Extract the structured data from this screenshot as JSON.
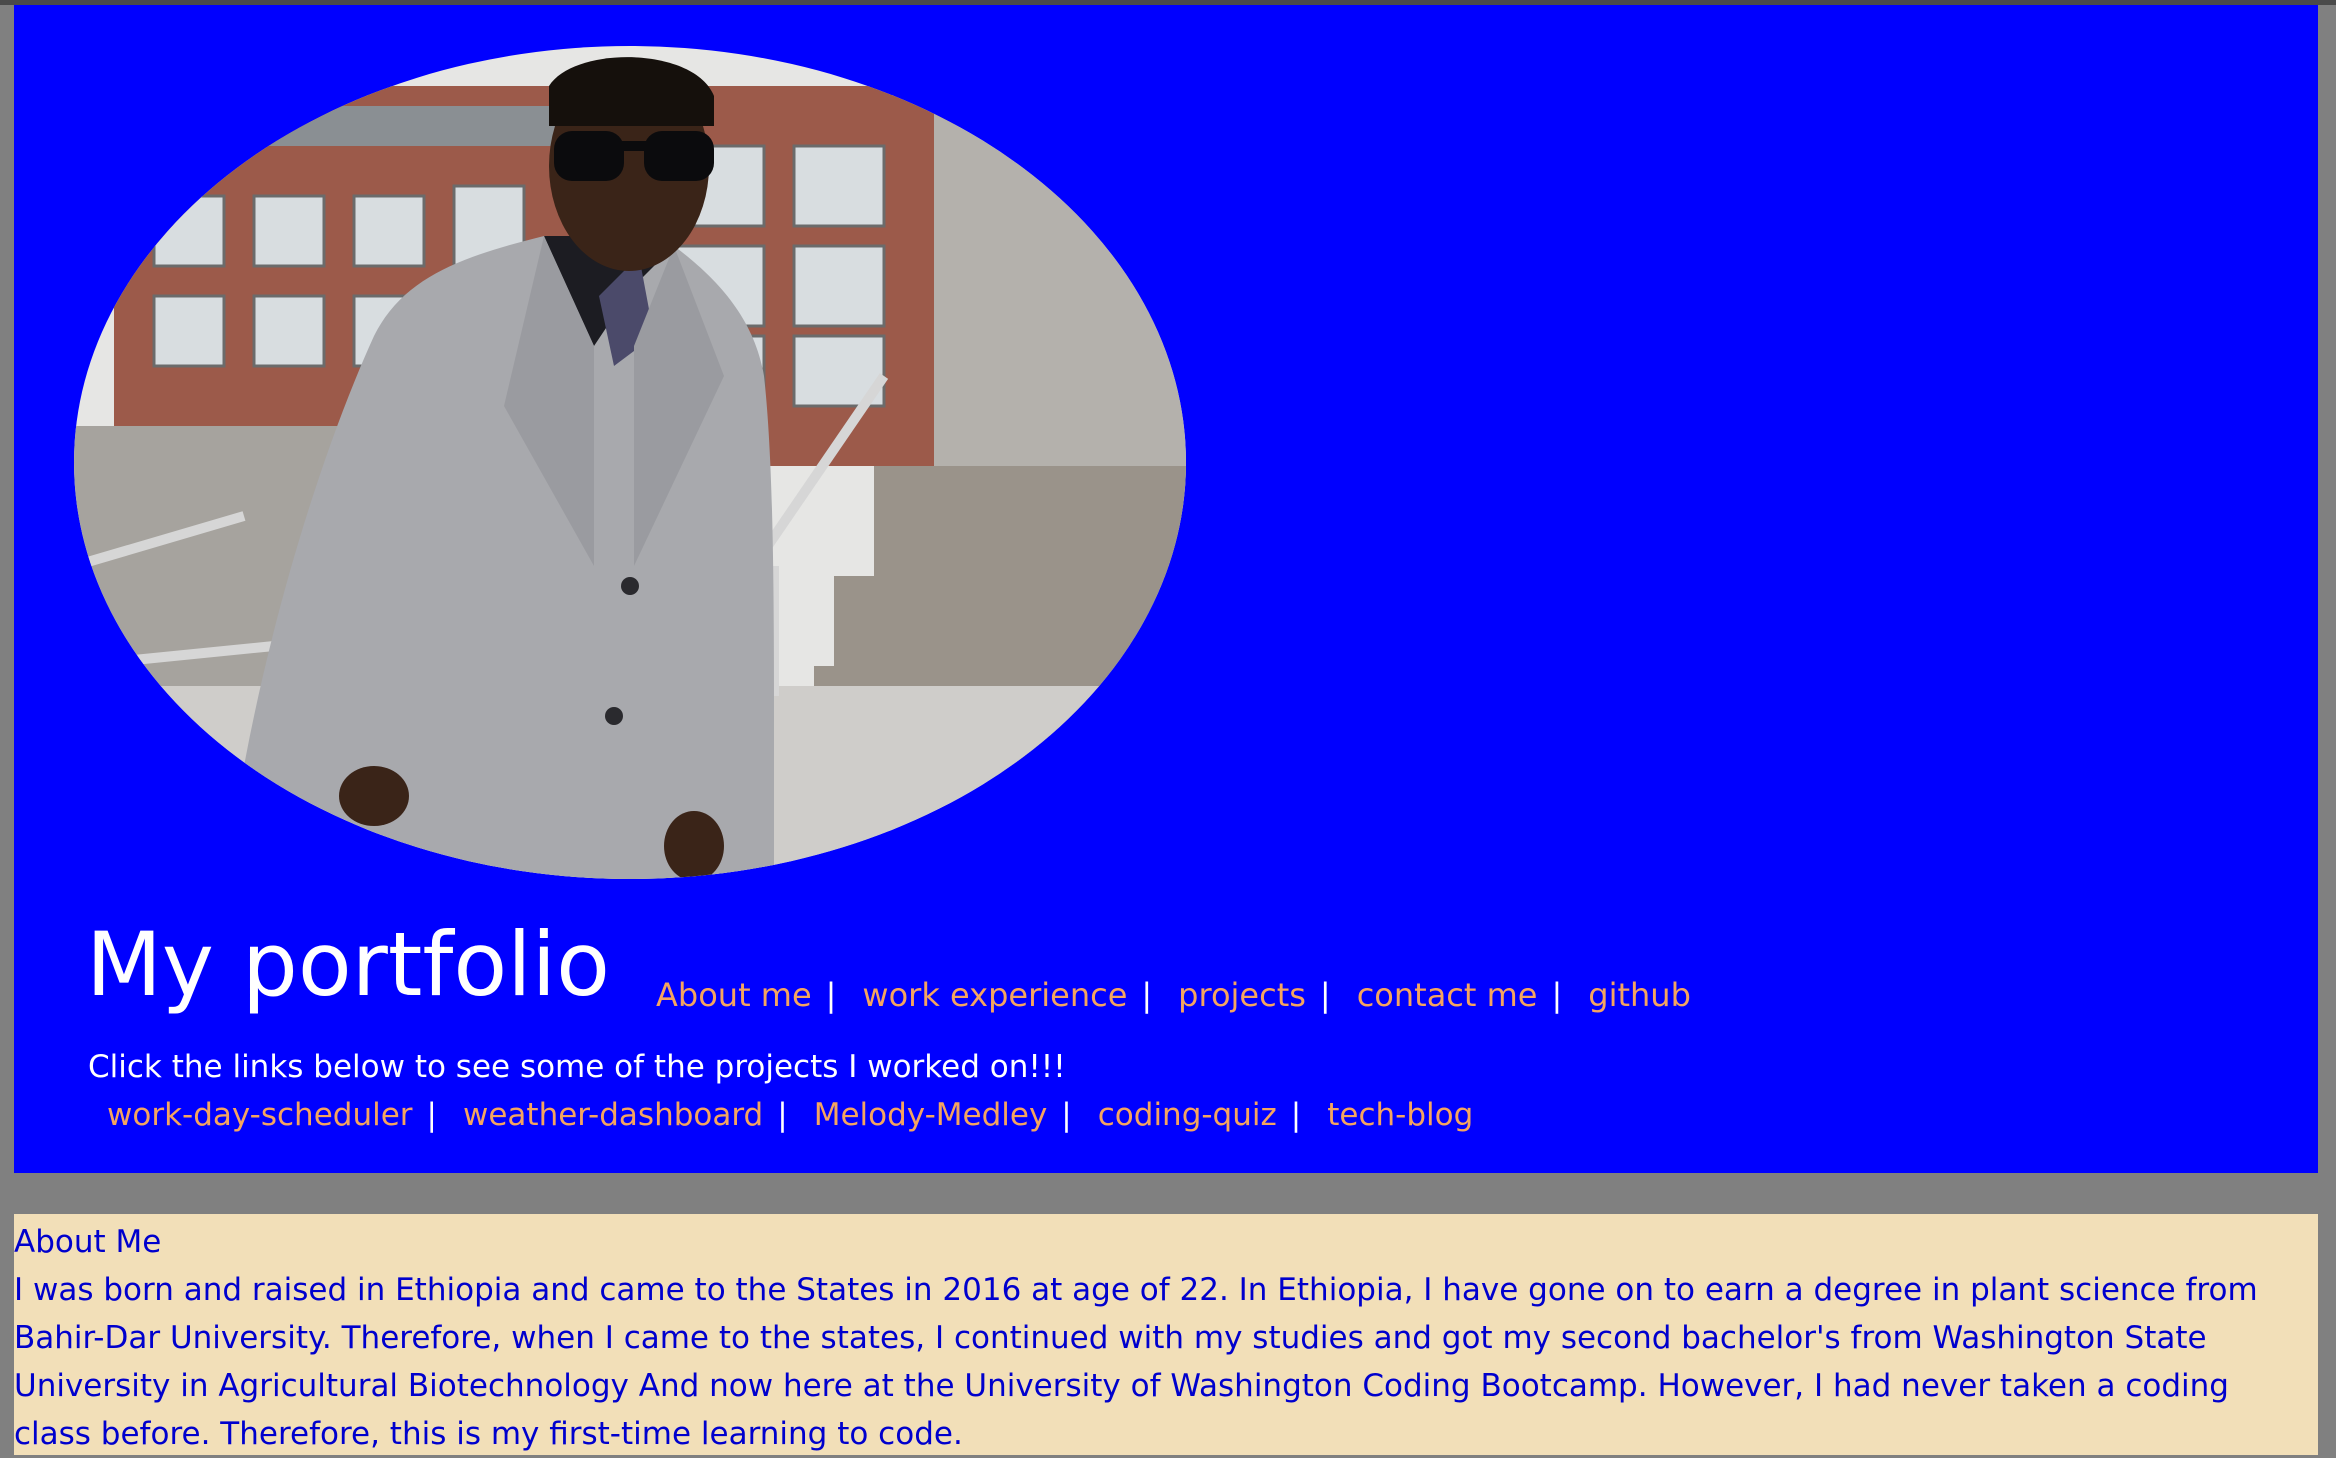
{
  "header": {
    "title": "My portfolio",
    "photo_alt": "portrait photo in grey suit in front of a building",
    "nav": [
      {
        "label": "About me"
      },
      {
        "label": "work experience"
      },
      {
        "label": "projects"
      },
      {
        "label": "contact me"
      },
      {
        "label": "github"
      }
    ],
    "separator": "|",
    "tagline": "Click the links below to see some of the projects I worked on!!!",
    "projects": [
      {
        "label": "work-day-scheduler"
      },
      {
        "label": "weather-dashboard"
      },
      {
        "label": "Melody-Medley"
      },
      {
        "label": "coding-quiz"
      },
      {
        "label": "tech-blog"
      }
    ]
  },
  "about": {
    "heading": "About Me",
    "text": "I was born and raised in Ethiopia and came to the States in 2016 at age of 22. In Ethiopia, I have gone on to earn a degree in plant science from Bahir-Dar University. Therefore, when I came to the states, I continued with my studies and got my second bachelor's from Washington State University in Agricultural Biotechnology And now here at the University of Washington Coding Bootcamp. However, I had never taken a coding class before. Therefore, this is my first-time learning to code."
  },
  "colors": {
    "page_background": "#808080",
    "header_background": "#0000ff",
    "link": "#f4a460",
    "header_text": "#ffffff",
    "about_background": "#f2dfb8",
    "about_text": "#0000cd"
  }
}
